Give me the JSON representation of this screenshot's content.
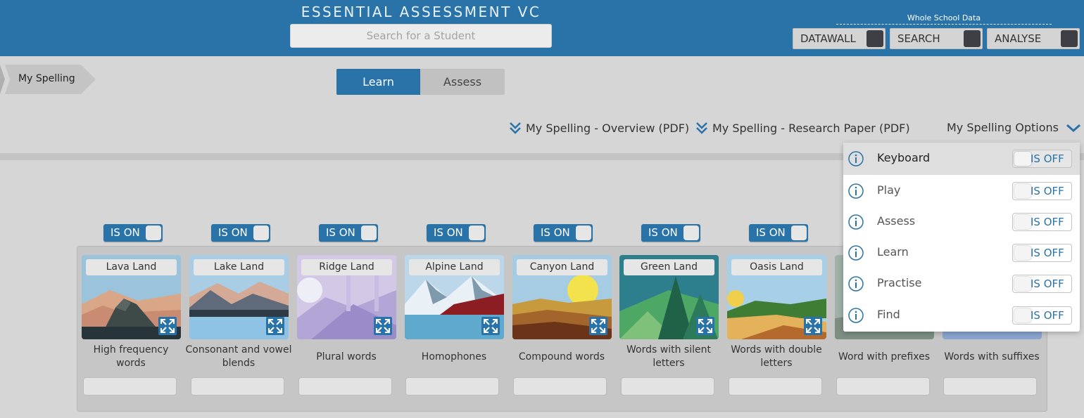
{
  "header": {
    "title": "ESSENTIAL ASSESSMENT VC",
    "search_placeholder": "Search for a Student",
    "whole_school_label": "Whole School Data",
    "buttons": [
      {
        "label": "DATAWALL"
      },
      {
        "label": "SEARCH"
      },
      {
        "label": "ANALYSE"
      }
    ],
    "brand_color": "#2a73a8"
  },
  "breadcrumb": {
    "label": "My Spelling"
  },
  "tabs": [
    {
      "label": "Learn",
      "active": true
    },
    {
      "label": "Assess",
      "active": false
    }
  ],
  "links": {
    "overview": "My Spelling - Overview (PDF)",
    "research": "My Spelling - Research Paper (PDF)",
    "options": "My Spelling Options"
  },
  "lands": [
    {
      "toggle": "IS ON",
      "name": "Lava Land",
      "caption": "High frequency words"
    },
    {
      "toggle": "IS ON",
      "name": "Lake Land",
      "caption": "Consonant and vowel blends"
    },
    {
      "toggle": "IS ON",
      "name": "Ridge Land",
      "caption": "Plural words"
    },
    {
      "toggle": "IS ON",
      "name": "Alpine Land",
      "caption": "Homophones"
    },
    {
      "toggle": "IS ON",
      "name": "Canyon Land",
      "caption": "Compound words"
    },
    {
      "toggle": "IS ON",
      "name": "Green Land",
      "caption": "Words with silent letters"
    },
    {
      "toggle": "IS ON",
      "name": "Oasis Land",
      "caption": "Words with double letters"
    },
    {
      "caption": "Word with prefixes"
    },
    {
      "caption": "Words with suffixes"
    }
  ],
  "options_menu": [
    {
      "label": "Keyboard",
      "state": "IS OFF"
    },
    {
      "label": "Play",
      "state": "IS OFF"
    },
    {
      "label": "Assess",
      "state": "IS OFF"
    },
    {
      "label": "Learn",
      "state": "IS OFF"
    },
    {
      "label": "Practise",
      "state": "IS OFF"
    },
    {
      "label": "Find",
      "state": "IS OFF"
    }
  ]
}
